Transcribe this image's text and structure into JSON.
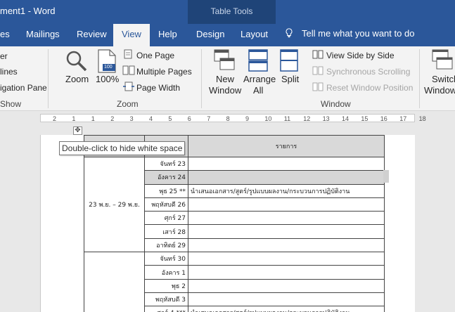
{
  "window": {
    "title": "ment1  -  Word",
    "context_group": "Table Tools"
  },
  "tabs": {
    "insert_partial": "es",
    "mailings": "Mailings",
    "review": "Review",
    "view": "View",
    "help": "Help",
    "design": "Design",
    "layout": "Layout",
    "tell_me": "Tell me what you want to do"
  },
  "ribbon": {
    "show": {
      "ruler_partial": "er",
      "gridlines_partial": "lines",
      "navpane_partial": "igation Pane",
      "label_partial": "Show"
    },
    "zoom": {
      "zoom_label": "Zoom",
      "percent_label": "100%",
      "percent_icon_text": "100",
      "one_page": "One Page",
      "multiple_pages": "Multiple Pages",
      "page_width": "Page Width",
      "group_label": "Zoom"
    },
    "window": {
      "new_window_1": "New",
      "new_window_2": "Window",
      "arrange_1": "Arrange",
      "arrange_2": "All",
      "split": "Split",
      "view_side": "View Side by Side",
      "sync_scroll": "Synchronous Scrolling",
      "reset_pos": "Reset Window Position",
      "switch_1": "Switch",
      "switch_2": "Window",
      "group_label": "Window"
    }
  },
  "ruler": {
    "ticks": [
      "2",
      "1",
      "1",
      "2",
      "3",
      "4",
      "5",
      "6",
      "7",
      "8",
      "9",
      "10",
      "11",
      "12",
      "13",
      "14",
      "15",
      "16",
      "17",
      "18"
    ]
  },
  "tooltip": "Double-click to hide white space",
  "table": {
    "header_item": "รายการ",
    "range_1": "23 พ.ย. – 29 พ.ย.",
    "rows": [
      {
        "day": "จันทร์ 23",
        "item": ""
      },
      {
        "day": "อังคาร 24",
        "item": ""
      },
      {
        "day": "พุธ 25 **",
        "item": "นำเสนอเอกสาร/สูตร์/รูปแบบผลงาน/กระบวนการปฏิบัติงาน"
      },
      {
        "day": "พฤหัสบดี 26",
        "item": ""
      },
      {
        "day": "ศุกร์ 27",
        "item": ""
      },
      {
        "day": "เสาร์ 28",
        "item": ""
      },
      {
        "day": "อาทิตย์ 29",
        "item": ""
      },
      {
        "day": "จันทร์ 30",
        "item": ""
      },
      {
        "day": "อังคาร 1",
        "item": ""
      },
      {
        "day": "พุธ 2",
        "item": ""
      },
      {
        "day": "พฤหัสบดี 3",
        "item": ""
      },
      {
        "day": "ศุกร์ 4 ***",
        "item": "นำเสนอเอกสาร/สูตร์/รูปแบบผลงาน/กระบวนการปฏิบัติงาน"
      }
    ]
  }
}
